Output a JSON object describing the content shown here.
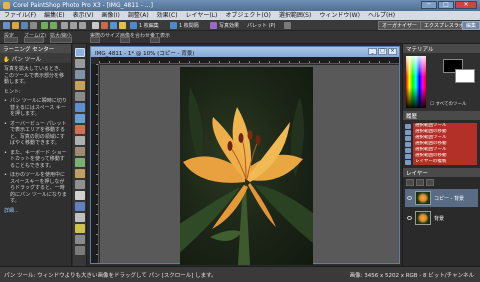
{
  "app": {
    "title": "Corel PaintShop Photo Pro X3 - [IMG_4811 - ...]",
    "window_buttons": [
      "─",
      "□",
      "✕"
    ]
  },
  "menu": [
    "ファイル(F)",
    "編集(E)",
    "表示(V)",
    "画像(I)",
    "調整(A)",
    "効果(C)",
    "レイヤー(L)",
    "オブジェクト(O)",
    "選択範囲(S)",
    "ウィンドウ(W)",
    "ヘルプ(H)"
  ],
  "toolbar": {
    "fit_label": "1 枚編集",
    "fit2_label": "1 枚間隔",
    "adjust_label": "写真効果",
    "palette_label": "パレット (P)",
    "workspaces": [
      "オーガナイザー",
      "エクスプレスラボ",
      "編集"
    ]
  },
  "options_bar": {
    "labels": [
      "設定",
      "ズーム(Z)",
      "拡大/縮小",
      "実際のサイズ",
      "画像を合わせる",
      "全て表示"
    ]
  },
  "learning_center": {
    "header": "ラーニング センター",
    "subheader": "パン ツール",
    "intro": "写真を拡大しているとき、このツールで表示部分を移動します。",
    "hint_title": "ヒント:",
    "bullets": [
      "パン ツールに瞬時に切り替えるにはスペース キーを押します。",
      "オーバービュー パレットで表示エリアを移動すると、写真の別の領域にすばやく移動できます。",
      "また、キーボード ショートカットを使って移動することもできます。",
      "ほかのツールを使用中にスペースキーを押しながらドラッグすると、一時的にパン ツールになります。"
    ],
    "more": "詳細..."
  },
  "document": {
    "title": "IMG_4811 - 1* @ 10% (コピー - 背景)",
    "buttons": [
      "_",
      "□",
      "×"
    ]
  },
  "materials": {
    "header": "マテリアル",
    "all_tools": "すべてのツール"
  },
  "history": {
    "header": "履歴",
    "items": [
      "選択範囲ツール",
      "選択範囲の移動",
      "選択範囲ツール",
      "選択範囲の移動",
      "選択範囲ツール",
      "選択範囲の移動",
      "レイヤーの複製"
    ]
  },
  "layers": {
    "header": "レイヤー",
    "rows": [
      {
        "name": "コピー - 背景",
        "selected": true
      },
      {
        "name": "背景",
        "selected": false
      }
    ]
  },
  "status": {
    "message": "パン ツール: ウィンドウよりも大きい画像をドラッグして パン [スクロール] します。",
    "info": "画像: 3456 x 5202 x RGB - 8 ビット/チャンネル"
  },
  "colors": {
    "foreground": "#000000",
    "background": "#ffffff",
    "accent": "#5a7fae",
    "history_highlight": "#b33028"
  }
}
